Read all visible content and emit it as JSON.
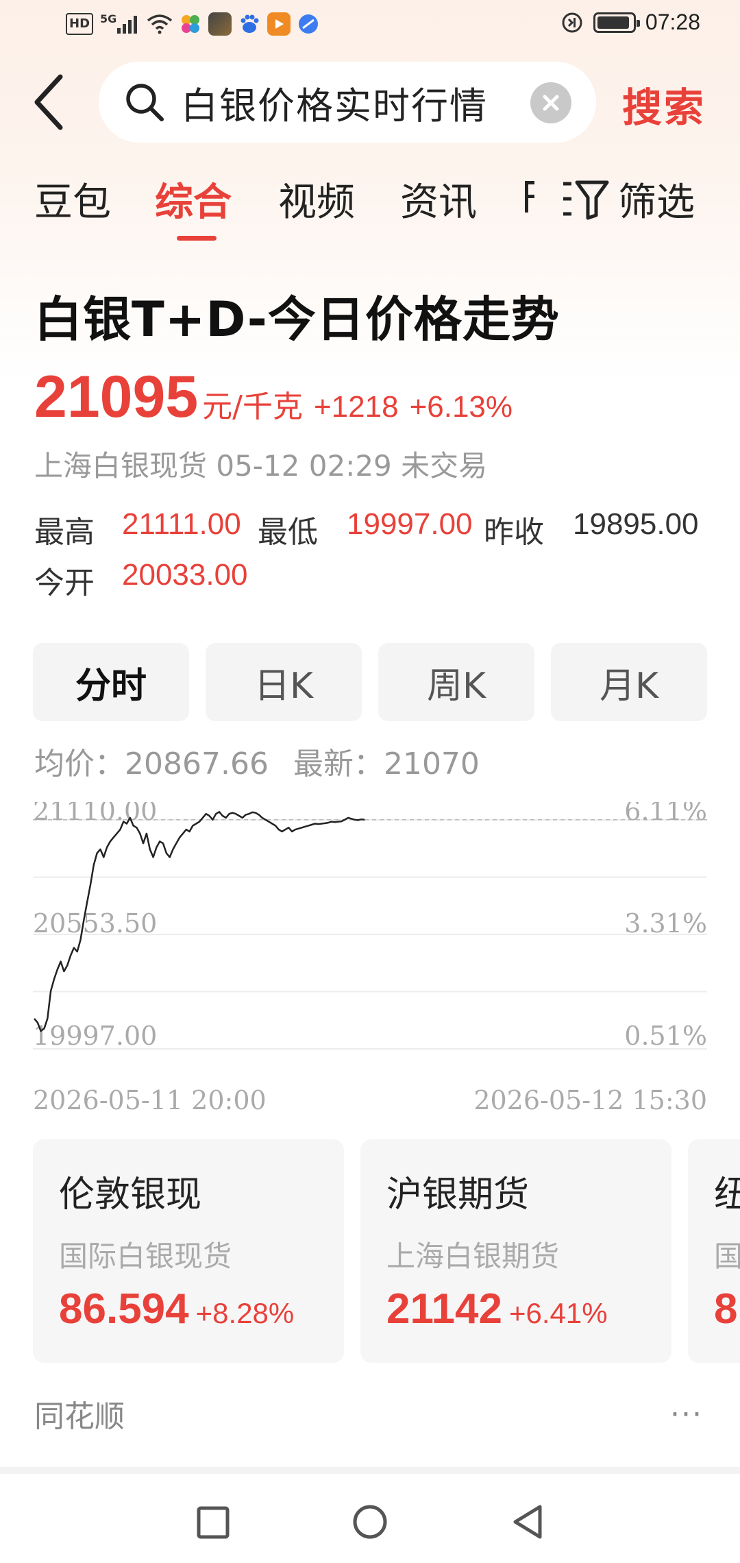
{
  "status_bar": {
    "left_indicators": [
      "HD",
      "5G"
    ],
    "time": "07:28",
    "battery_level": 0.92
  },
  "search": {
    "query": "白银价格实时行情",
    "submit_label": "搜索"
  },
  "tabs": [
    {
      "label": "豆包",
      "active": false
    },
    {
      "label": "综合",
      "active": true
    },
    {
      "label": "视频",
      "active": false
    },
    {
      "label": "资讯",
      "active": false
    }
  ],
  "filter_label": "筛选",
  "quote": {
    "title": "白银T+D-今日价格走势",
    "price": "21095",
    "unit": "元/千克",
    "change": "+1218",
    "change_pct": "+6.13%",
    "subtitle": "上海白银现货 05-12 02:29 未交易",
    "high_label": "最高",
    "high": "21111.00",
    "low_label": "最低",
    "low": "19997.00",
    "prev_close_label": "昨收",
    "prev_close": "19895.00",
    "open_label": "今开",
    "open": "20033.00"
  },
  "periods": [
    {
      "label": "分时",
      "active": true
    },
    {
      "label": "日K",
      "active": false
    },
    {
      "label": "周K",
      "active": false
    },
    {
      "label": "月K",
      "active": false
    }
  ],
  "chart_summary": {
    "avg_label": "均价：",
    "avg": "20867.66",
    "latest_label": "最新：",
    "latest": "21070"
  },
  "chart_data": {
    "type": "line",
    "y_labels": [
      "21110.00",
      "20553.50",
      "19997.00"
    ],
    "right_labels": [
      "6.11%",
      "3.31%",
      "0.51%"
    ],
    "x_labels": [
      "2026-05-11 20:00",
      "2026-05-12 15:30"
    ],
    "ylim": [
      19997.0,
      21111.0
    ],
    "reference_line": 21070,
    "series": [
      {
        "values": [
          20060,
          20040,
          19997,
          20010,
          20060,
          20200,
          20260,
          20310,
          20350,
          20300,
          20330,
          20380,
          20420,
          20400,
          20460,
          20560,
          20650,
          20740,
          20840,
          20900,
          20920,
          20880,
          20930,
          20960,
          20980,
          21000,
          21020,
          21060,
          21050,
          21080,
          21040,
          21030,
          21000,
          20950,
          21000,
          20920,
          20880,
          20930,
          20960,
          20950,
          20900,
          20880,
          20920,
          20950,
          20980,
          21000,
          21020,
          21010,
          21040,
          21050,
          21060,
          21080,
          21100,
          21090,
          21070,
          21100,
          21110,
          21090,
          21080,
          21100,
          21105,
          21100,
          21090,
          21080,
          21095,
          21100,
          21108,
          21105,
          21095,
          21080,
          21070,
          21060,
          21050,
          21040,
          21020,
          21010,
          21020,
          21030,
          21010,
          21020,
          21025,
          21030,
          21035,
          21040,
          21045,
          21050,
          21048,
          21050,
          21052,
          21055,
          21060,
          21058,
          21060,
          21062,
          21070,
          21080,
          21075,
          21070,
          21068,
          21072,
          21070
        ]
      }
    ],
    "session_fraction": 0.49
  },
  "cards": [
    {
      "title": "伦敦银现",
      "subtitle": "国际白银现货",
      "value": "86.594",
      "pct": "+8.28%"
    },
    {
      "title": "沪银期货",
      "subtitle": "上海白银期货",
      "value": "21142",
      "pct": "+6.41%"
    },
    {
      "title": "纽",
      "subtitle": "国",
      "value": "8",
      "pct": ""
    }
  ],
  "source": "同花顺",
  "more_label": "···"
}
